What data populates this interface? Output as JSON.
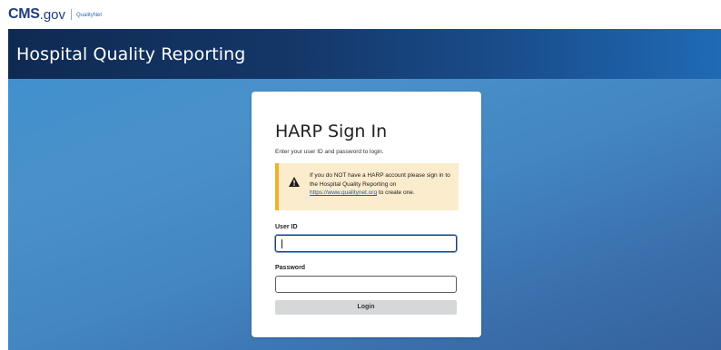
{
  "header": {
    "logo_primary": "CMS",
    "logo_secondary": ".gov",
    "logo_partner": "QualityNet"
  },
  "banner": {
    "title": "Hospital Quality Reporting"
  },
  "signin": {
    "title": "HARP Sign In",
    "subtitle": "Enter your user ID and password to login.",
    "alert": {
      "icon": "warning-triangle-icon",
      "text_before": "If you do NOT have a HARP account please sign in to the Hospital Quality Reporting on ",
      "link_text": "https://www.qualitynet.org",
      "text_after": " to create one."
    },
    "user_id": {
      "label": "User ID",
      "value": ""
    },
    "password": {
      "label": "Password",
      "value": ""
    },
    "login_label": "Login"
  },
  "colors": {
    "brand_navy": "#1f3d7a",
    "alert_bg": "#fbeccd",
    "alert_border": "#f2b12d",
    "button_bg": "#d6d7d9",
    "link": "#1a5fb4"
  }
}
